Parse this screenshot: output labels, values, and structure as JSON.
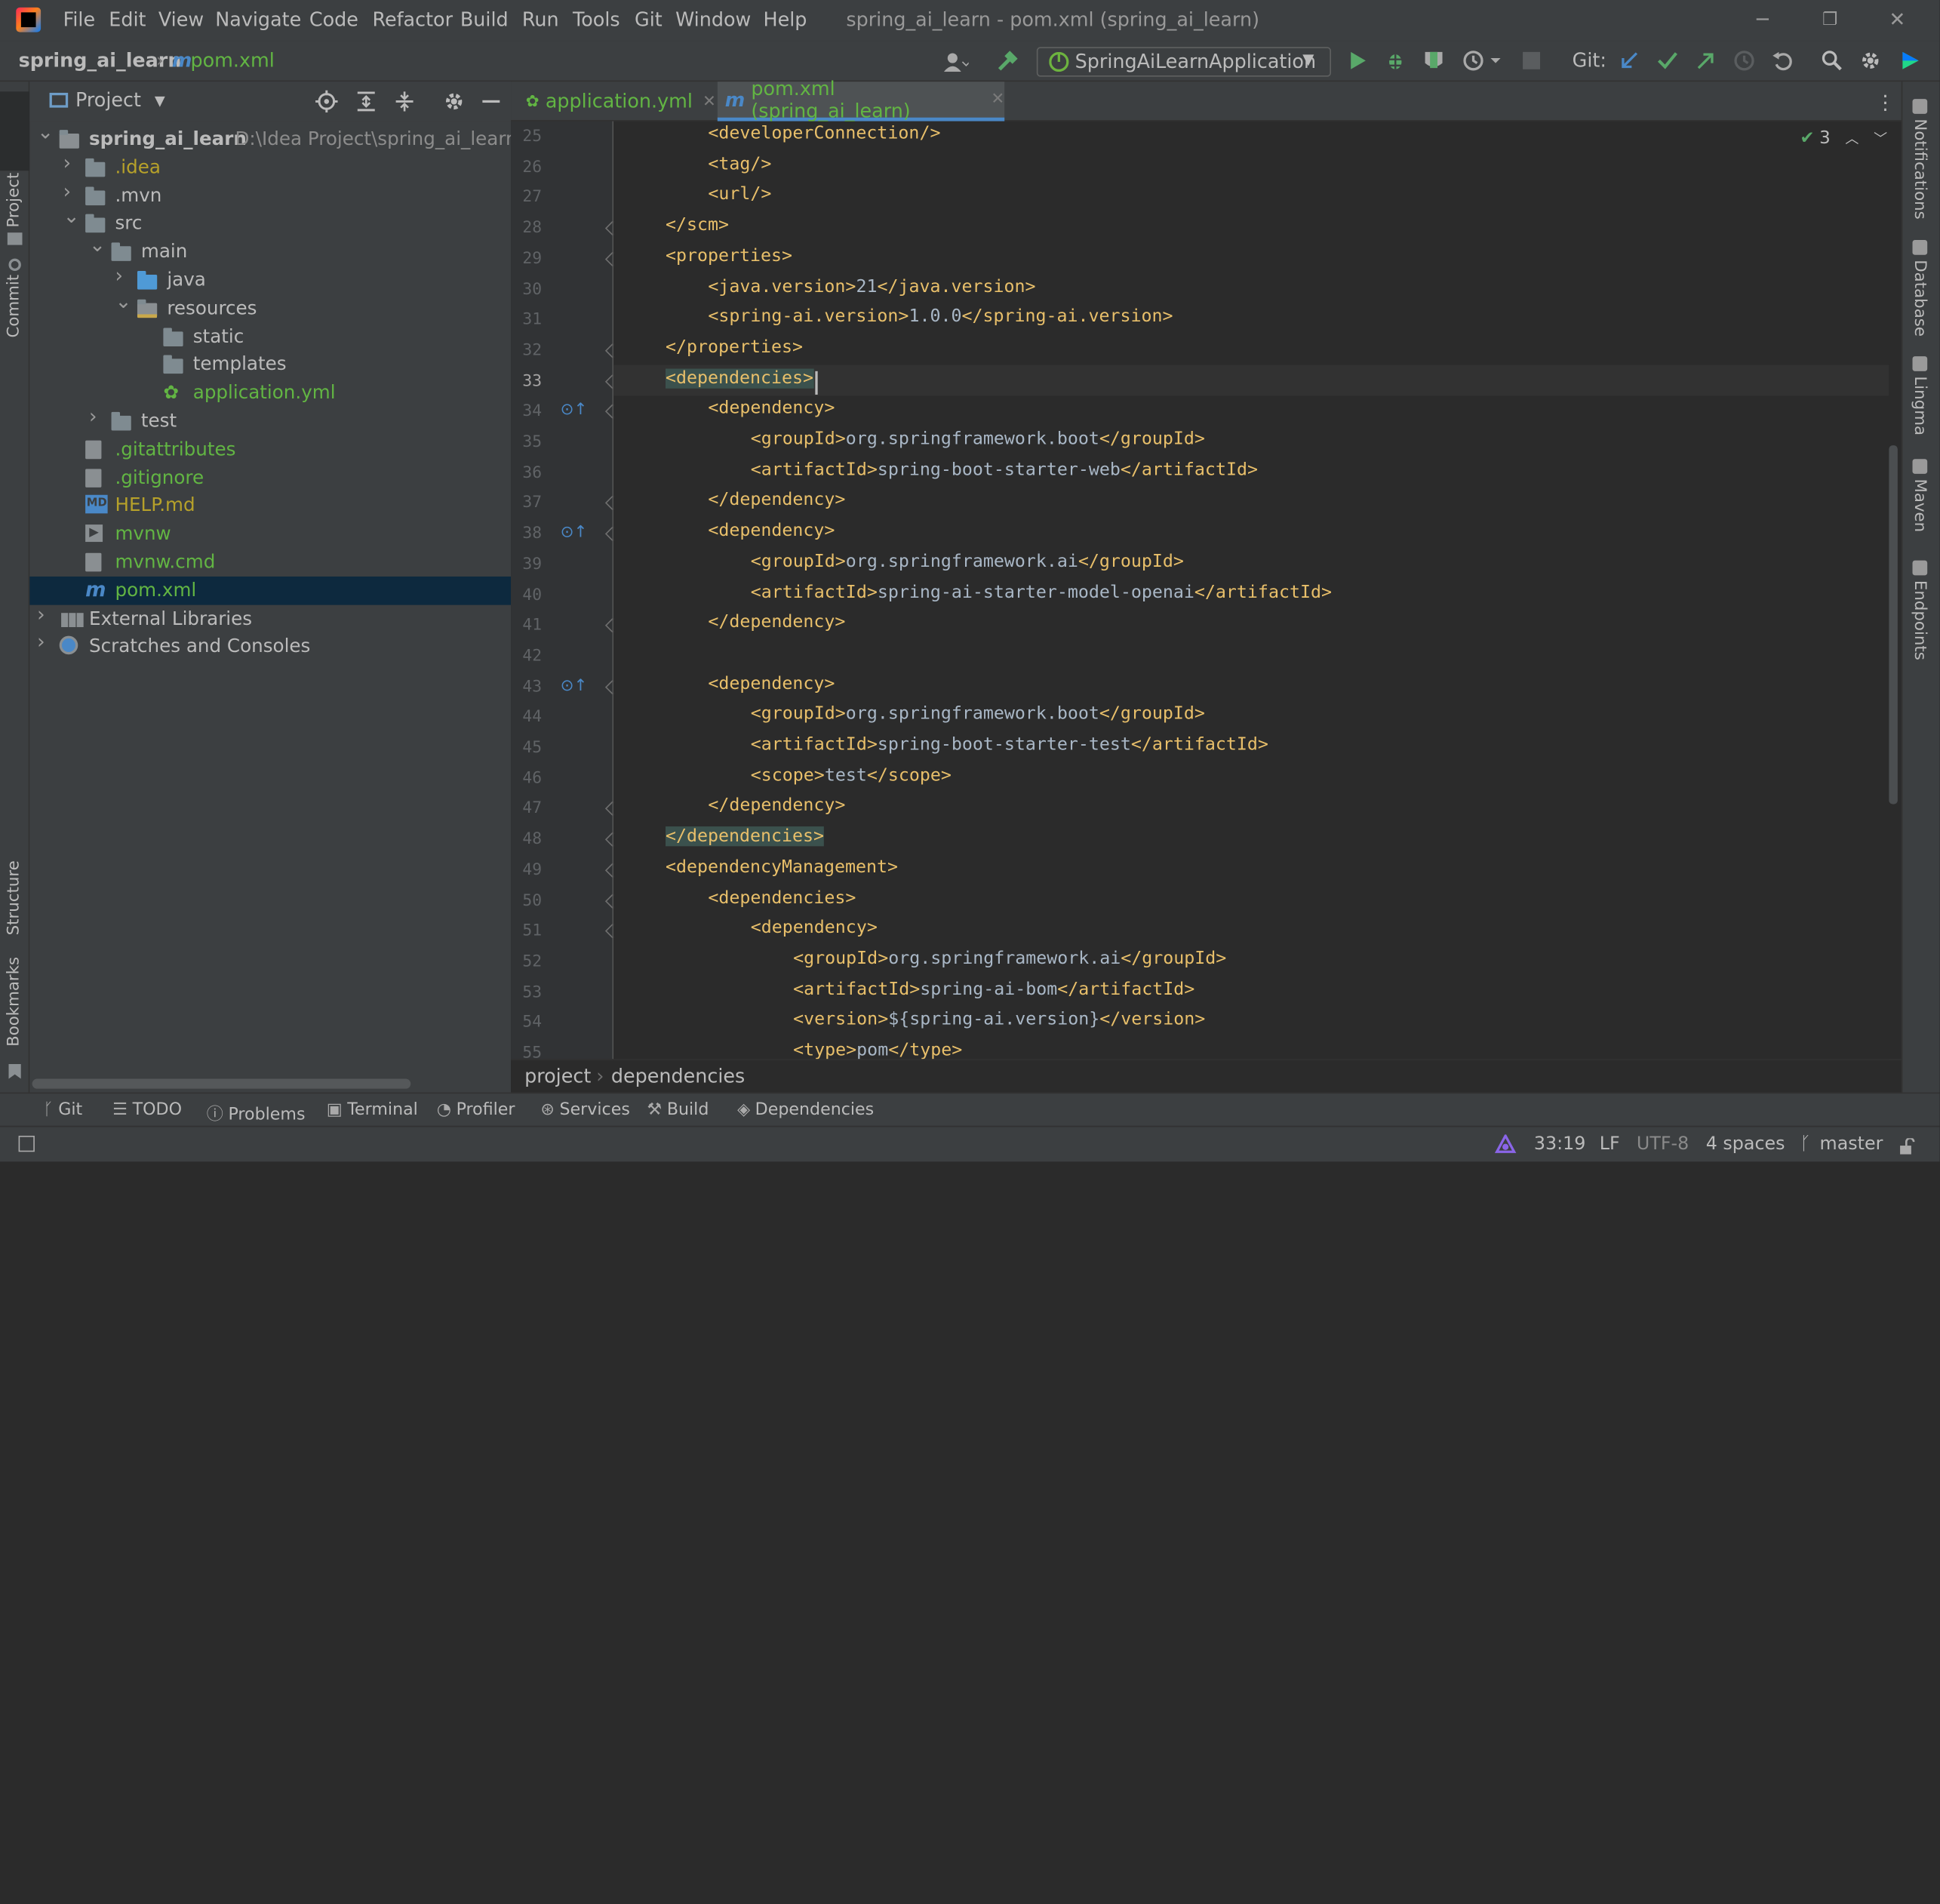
{
  "window": {
    "title": "spring_ai_learn - pom.xml (spring_ai_learn)",
    "menu": [
      "File",
      "Edit",
      "View",
      "Navigate",
      "Code",
      "Refactor",
      "Build",
      "Run",
      "Tools",
      "Git",
      "Window",
      "Help"
    ]
  },
  "navbar": {
    "project": "spring_ai_learn",
    "file": "pom.xml",
    "run_config": "SpringAiLearnApplication",
    "git_label": "Git:"
  },
  "left_stripe": [
    "Project",
    "Commit",
    "Structure",
    "Bookmarks"
  ],
  "right_stripe": [
    "Notifications",
    "Database",
    "Lingma",
    "Maven",
    "Endpoints"
  ],
  "project_panel": {
    "title": "Project",
    "tree": [
      {
        "label": "spring_ai_learn",
        "path": "D:\\Idea Project\\spring_ai_learn\\s",
        "kind": "module",
        "expanded": true,
        "level": 0,
        "color": "#bbbbbb"
      },
      {
        "label": ".idea",
        "kind": "folder",
        "expanded": false,
        "level": 1,
        "color": "#b6a12a"
      },
      {
        "label": ".mvn",
        "kind": "folder",
        "expanded": false,
        "level": 1,
        "color": "#bbbbbb"
      },
      {
        "label": "src",
        "kind": "folder",
        "expanded": true,
        "level": 1,
        "color": "#bbbbbb"
      },
      {
        "label": "main",
        "kind": "folder",
        "expanded": true,
        "level": 2,
        "color": "#bbbbbb"
      },
      {
        "label": "java",
        "kind": "folder-blue",
        "expanded": false,
        "level": 3,
        "color": "#bbbbbb"
      },
      {
        "label": "resources",
        "kind": "folder-res",
        "expanded": true,
        "level": 3,
        "color": "#bbbbbb"
      },
      {
        "label": "static",
        "kind": "folder",
        "level": 4,
        "color": "#bbbbbb"
      },
      {
        "label": "templates",
        "kind": "folder",
        "level": 4,
        "color": "#bbbbbb"
      },
      {
        "label": "application.yml",
        "kind": "yml",
        "level": 4,
        "color": "#62b543"
      },
      {
        "label": "test",
        "kind": "folder",
        "expanded": false,
        "level": 2,
        "color": "#bbbbbb"
      },
      {
        "label": ".gitattributes",
        "kind": "file",
        "level": 1,
        "color": "#62b543"
      },
      {
        "label": ".gitignore",
        "kind": "file",
        "level": 1,
        "color": "#62b543"
      },
      {
        "label": "HELP.md",
        "kind": "md",
        "level": 1,
        "color": "#b6a12a"
      },
      {
        "label": "mvnw",
        "kind": "exec",
        "level": 1,
        "color": "#62b543"
      },
      {
        "label": "mvnw.cmd",
        "kind": "file",
        "level": 1,
        "color": "#62b543"
      },
      {
        "label": "pom.xml",
        "kind": "maven",
        "level": 1,
        "color": "#62b543",
        "selected": true
      },
      {
        "label": "External Libraries",
        "kind": "libs",
        "expanded": false,
        "level": 0,
        "color": "#bbbbbb"
      },
      {
        "label": "Scratches and Consoles",
        "kind": "scratch",
        "expanded": false,
        "level": 0,
        "color": "#bbbbbb"
      }
    ]
  },
  "tabs": [
    {
      "label": "application.yml",
      "active": false,
      "color": "#62b543"
    },
    {
      "label": "pom.xml (spring_ai_learn)",
      "active": true,
      "color": "#62b543"
    }
  ],
  "inspections": {
    "count": "3"
  },
  "editor": {
    "current_line": "33",
    "lines": [
      {
        "n": "25",
        "indent": 2,
        "text": "<developerConnection/>"
      },
      {
        "n": "26",
        "indent": 2,
        "text": "<tag/>"
      },
      {
        "n": "27",
        "indent": 2,
        "text": "<url/>"
      },
      {
        "n": "28",
        "indent": 1,
        "text": "</scm>"
      },
      {
        "n": "29",
        "indent": 1,
        "text": "<properties>"
      },
      {
        "n": "30",
        "indent": 2,
        "text": "<java.version>21</java.version>"
      },
      {
        "n": "31",
        "indent": 2,
        "text": "<spring-ai.version>1.0.0</spring-ai.version>"
      },
      {
        "n": "32",
        "indent": 1,
        "text": "</properties>"
      },
      {
        "n": "33",
        "indent": 1,
        "text": "<dependencies>",
        "hl": true
      },
      {
        "n": "34",
        "indent": 2,
        "text": "<dependency>"
      },
      {
        "n": "35",
        "indent": 3,
        "text": "<groupId>org.springframework.boot</groupId>"
      },
      {
        "n": "36",
        "indent": 3,
        "text": "<artifactId>spring-boot-starter-web</artifactId>"
      },
      {
        "n": "37",
        "indent": 2,
        "text": "</dependency>"
      },
      {
        "n": "38",
        "indent": 2,
        "text": "<dependency>"
      },
      {
        "n": "39",
        "indent": 3,
        "text": "<groupId>org.springframework.ai</groupId>"
      },
      {
        "n": "40",
        "indent": 3,
        "text": "<artifactId>spring-ai-starter-model-openai</artifactId>"
      },
      {
        "n": "41",
        "indent": 2,
        "text": "</dependency>"
      },
      {
        "n": "42",
        "indent": 0,
        "text": ""
      },
      {
        "n": "43",
        "indent": 2,
        "text": "<dependency>"
      },
      {
        "n": "44",
        "indent": 3,
        "text": "<groupId>org.springframework.boot</groupId>"
      },
      {
        "n": "45",
        "indent": 3,
        "text": "<artifactId>spring-boot-starter-test</artifactId>"
      },
      {
        "n": "46",
        "indent": 3,
        "text": "<scope>test</scope>"
      },
      {
        "n": "47",
        "indent": 2,
        "text": "</dependency>"
      },
      {
        "n": "48",
        "indent": 1,
        "text": "</dependencies>",
        "hl": true
      },
      {
        "n": "49",
        "indent": 1,
        "text": "<dependencyManagement>"
      },
      {
        "n": "50",
        "indent": 2,
        "text": "<dependencies>"
      },
      {
        "n": "51",
        "indent": 3,
        "text": "<dependency>"
      },
      {
        "n": "52",
        "indent": 4,
        "text": "<groupId>org.springframework.ai</groupId>"
      },
      {
        "n": "53",
        "indent": 4,
        "text": "<artifactId>spring-ai-bom</artifactId>"
      },
      {
        "n": "54",
        "indent": 4,
        "text": "<version>${spring-ai.version}</version>"
      },
      {
        "n": "55",
        "indent": 4,
        "text": "<type>pom</type>"
      }
    ],
    "override_markers": [
      "34",
      "38",
      "43"
    ],
    "breadcrumb": [
      "project",
      "dependencies"
    ]
  },
  "bottom_tools": [
    {
      "label": "Git",
      "icon": "git-branch-icon"
    },
    {
      "label": "TODO",
      "icon": "list-icon"
    },
    {
      "label": "Problems",
      "icon": "problems-icon"
    },
    {
      "label": "Terminal",
      "icon": "terminal-icon"
    },
    {
      "label": "Profiler",
      "icon": "profiler-icon"
    },
    {
      "label": "Services",
      "icon": "services-icon"
    },
    {
      "label": "Build",
      "icon": "hammer-icon"
    },
    {
      "label": "Dependencies",
      "icon": "dependencies-icon"
    }
  ],
  "status": {
    "position": "33:19",
    "line_sep": "LF",
    "encoding": "UTF-8",
    "indent": "4 spaces",
    "branch": "master"
  }
}
